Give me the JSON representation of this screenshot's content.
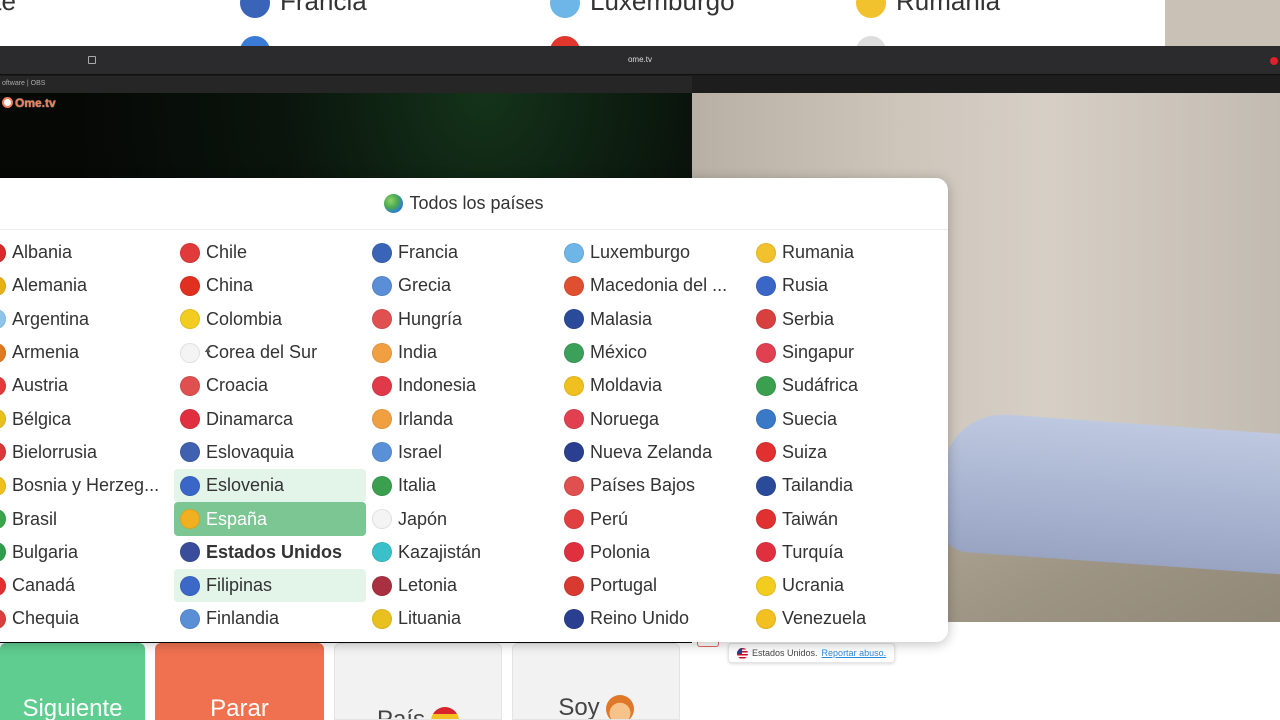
{
  "window": {
    "url": "ome.tv",
    "obs_label": "oftware | OBS",
    "brand": "Ome.tv"
  },
  "background_list": [
    {
      "label": "nite",
      "flag": "#ffffff"
    },
    {
      "label": "Francia",
      "flag": "#3a64b8"
    },
    {
      "label": "Luxemburgo",
      "flag": "#6fb6e8"
    },
    {
      "label": "Rumania",
      "flag": "#f2c22e"
    },
    {
      "label": "",
      "flag": "#3a7bd5"
    },
    {
      "label": "",
      "flag": "#e0362c"
    },
    {
      "label": "",
      "flag": "#dddddd"
    }
  ],
  "country_modal": {
    "title": "Todos los países",
    "columns": [
      [
        {
          "label": "Albania",
          "flag": "#d62c2c"
        },
        {
          "label": "Alemania",
          "flag": "#e8b018"
        },
        {
          "label": "Argentina",
          "flag": "#8ec5ea"
        },
        {
          "label": "Armenia",
          "flag": "#e07a20"
        },
        {
          "label": "Austria",
          "flag": "#e03c3c"
        },
        {
          "label": "Bélgica",
          "flag": "#e8c020"
        },
        {
          "label": "Bielorrusia",
          "flag": "#d83838"
        },
        {
          "label": "Bosnia y Herzeg...",
          "flag": "#f0c020"
        },
        {
          "label": "Brasil",
          "flag": "#3aa54a"
        },
        {
          "label": "Bulgaria",
          "flag": "#2e9e4c"
        },
        {
          "label": "Canadá",
          "flag": "#e03030"
        },
        {
          "label": "Chequia",
          "flag": "#d84040"
        }
      ],
      [
        {
          "label": "Chile",
          "flag": "#e03a3a"
        },
        {
          "label": "China",
          "flag": "#e03020"
        },
        {
          "label": "Colombia",
          "flag": "#f2cc1f"
        },
        {
          "label": "Corea del Sur",
          "flag": "#f4f4f4"
        },
        {
          "label": "Croacia",
          "flag": "#e05050"
        },
        {
          "label": "Dinamarca",
          "flag": "#e03040"
        },
        {
          "label": "Eslovaquia",
          "flag": "#4060b0"
        },
        {
          "label": "Eslovenia",
          "flag": "#3a66c8"
        },
        {
          "label": "España",
          "flag": "#f0b020"
        },
        {
          "label": "Estados Unidos",
          "flag": "#3a4d9a"
        },
        {
          "label": "Filipinas",
          "flag": "#3c68c8"
        },
        {
          "label": "Finlandia",
          "flag": "#5a8fd6"
        }
      ],
      [
        {
          "label": "Francia",
          "flag": "#3a64b8"
        },
        {
          "label": "Grecia",
          "flag": "#5a8ed6"
        },
        {
          "label": "Hungría",
          "flag": "#e05050"
        },
        {
          "label": "India",
          "flag": "#f0a040"
        },
        {
          "label": "Indonesia",
          "flag": "#e03a4a"
        },
        {
          "label": "Irlanda",
          "flag": "#f0a040"
        },
        {
          "label": "Israel",
          "flag": "#5a90d8"
        },
        {
          "label": "Italia",
          "flag": "#3aa050"
        },
        {
          "label": "Japón",
          "flag": "#f4f4f4"
        },
        {
          "label": "Kazajistán",
          "flag": "#3ac0c8"
        },
        {
          "label": "Letonia",
          "flag": "#a83040"
        },
        {
          "label": "Lituania",
          "flag": "#e8c020"
        }
      ],
      [
        {
          "label": "Luxemburgo",
          "flag": "#6fb6e8"
        },
        {
          "label": "Macedonia del ...",
          "flag": "#e05030"
        },
        {
          "label": "Malasia",
          "flag": "#2a4a9a"
        },
        {
          "label": "México",
          "flag": "#3aa05a"
        },
        {
          "label": "Moldavia",
          "flag": "#f0c020"
        },
        {
          "label": "Noruega",
          "flag": "#e04050"
        },
        {
          "label": "Nueva Zelanda",
          "flag": "#2a3f8f"
        },
        {
          "label": "Países Bajos",
          "flag": "#e05050"
        },
        {
          "label": "Perú",
          "flag": "#e04040"
        },
        {
          "label": "Polonia",
          "flag": "#e03040"
        },
        {
          "label": "Portugal",
          "flag": "#d83a30"
        },
        {
          "label": "Reino Unido",
          "flag": "#2a3f8f"
        }
      ],
      [
        {
          "label": "Rumania",
          "flag": "#f2c22e"
        },
        {
          "label": "Rusia",
          "flag": "#3a66c8"
        },
        {
          "label": "Serbia",
          "flag": "#d84040"
        },
        {
          "label": "Singapur",
          "flag": "#e04050"
        },
        {
          "label": "Sudáfrica",
          "flag": "#3aa050"
        },
        {
          "label": "Suecia",
          "flag": "#3a78c8"
        },
        {
          "label": "Suiza",
          "flag": "#e03030"
        },
        {
          "label": "Tailandia",
          "flag": "#2a4a9a"
        },
        {
          "label": "Taiwán",
          "flag": "#e03030"
        },
        {
          "label": "Turquía",
          "flag": "#e03040"
        },
        {
          "label": "Ucrania",
          "flag": "#f2cc1f"
        },
        {
          "label": "Venezuela",
          "flag": "#f2c020"
        }
      ]
    ],
    "hover_items": [
      "Eslovenia",
      "Filipinas"
    ],
    "selected_item": "España",
    "bold_item": "Estados Unidos"
  },
  "controls": {
    "next_label": "Siguiente",
    "stop_label": "Parar",
    "country_label": "País",
    "soy_label": "Soy"
  },
  "report": {
    "country": "Estados Unidos.",
    "link": "Reportar abuso."
  },
  "colors": {
    "next": "#5fcd8f",
    "stop": "#ef7150",
    "selected": "#7cc693",
    "hover": "#e3f4e9",
    "link": "#2a8ae0"
  }
}
